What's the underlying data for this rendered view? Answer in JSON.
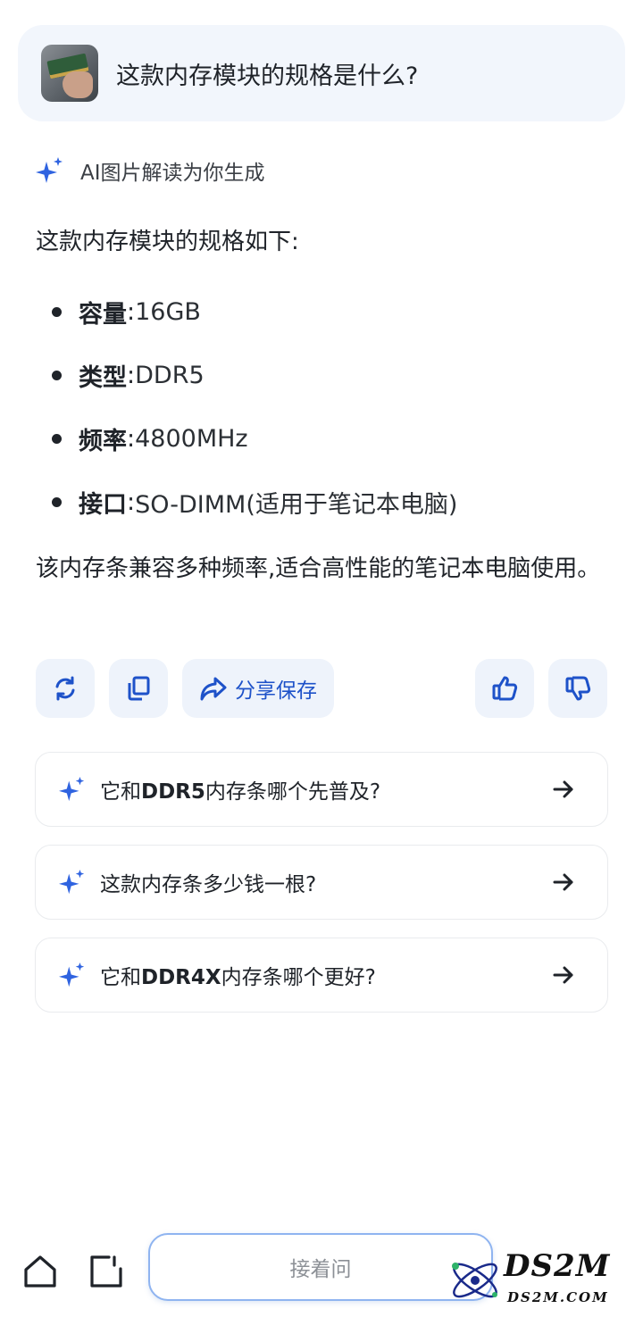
{
  "question": {
    "text": "这款内存模块的规格是什么?",
    "image_icon": "memory-module-photo"
  },
  "ai_header": {
    "label": "AI图片解读为你生成",
    "icon": "sparkle-icon"
  },
  "answer": {
    "intro": "这款内存模块的规格如下:",
    "specs": [
      {
        "key": "容量",
        "sep": ":",
        "value": "16GB"
      },
      {
        "key": "类型",
        "sep": ":",
        "value": "DDR5"
      },
      {
        "key": "频率",
        "sep": ":",
        "value": "4800MHz"
      },
      {
        "key": "接口",
        "sep": ":",
        "value": "SO-DIMM(适用于笔记本电脑)"
      }
    ],
    "summary": "该内存条兼容多种频率,适合高性能的笔记本电脑使用。"
  },
  "actions": {
    "share_label": "分享保存"
  },
  "suggestions": [
    {
      "pre": "它和",
      "bold": "DDR5",
      "post": "内存条哪个先普及?"
    },
    {
      "pre": "这款内存条多少钱一根?",
      "bold": "",
      "post": ""
    },
    {
      "pre": "它和",
      "bold": "DDR4X",
      "post": "内存条哪个更好?"
    }
  ],
  "bottom": {
    "ask_placeholder": "接着问"
  },
  "watermark": {
    "brand": "DS2M",
    "url": "DS2M.COM"
  },
  "colors": {
    "accent": "#1e52c9",
    "card_bg": "#f2f6fc",
    "action_bg": "#eef3fb",
    "input_border": "#8fb4f0"
  }
}
